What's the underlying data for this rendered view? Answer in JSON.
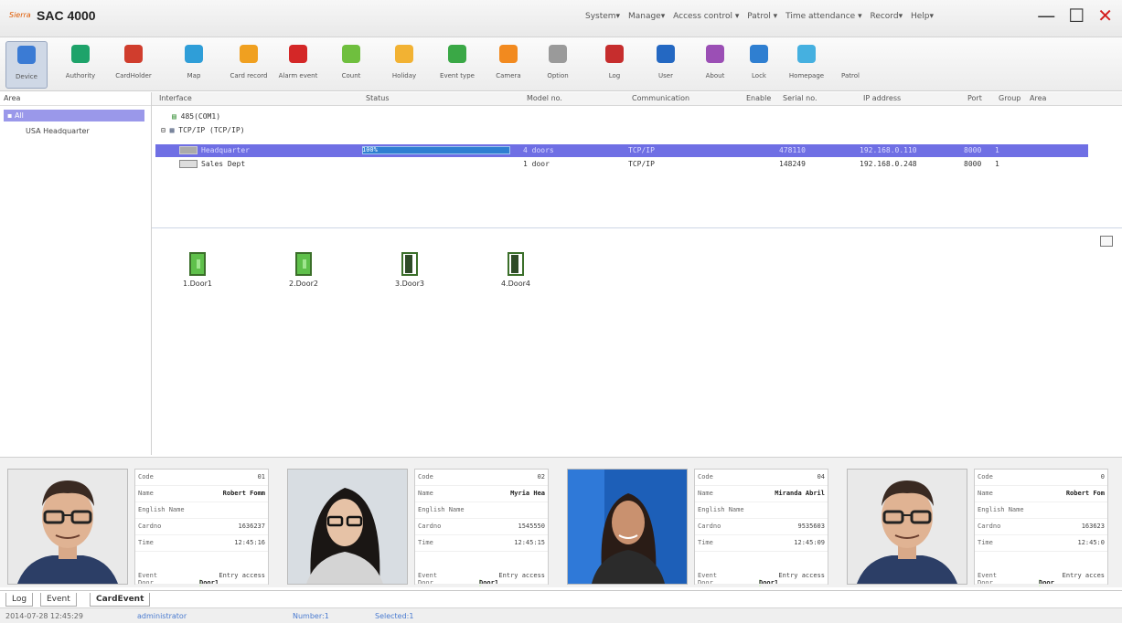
{
  "app": {
    "brand": "Sierra",
    "title": "SAC 4000"
  },
  "menu": [
    "System▾",
    "Manage▾",
    "Access control ▾",
    "Patrol ▾",
    "Time attendance ▾",
    "Record▾",
    "Help▾"
  ],
  "window_controls": {
    "minimize": "—",
    "maximize": "☐",
    "close": "✕"
  },
  "toolbar": [
    {
      "label": "Device",
      "icon": "device-icon",
      "color": "#3b7bd4",
      "active": true
    },
    {
      "label": "Authority",
      "icon": "authority-icon",
      "color": "#1ea36a"
    },
    {
      "label": "CardHolder",
      "icon": "cardholder-icon",
      "color": "#d03d2d"
    },
    {
      "label": "Map",
      "icon": "map-icon",
      "color": "#2f9ed8"
    },
    {
      "label": "Card record",
      "icon": "card-record-icon",
      "color": "#f0a020"
    },
    {
      "label": "Alarm event",
      "icon": "alarm-icon",
      "color": "#d42727"
    },
    {
      "label": "Count",
      "icon": "count-icon",
      "color": "#6fbf3e"
    },
    {
      "label": "Holiday",
      "icon": "holiday-icon",
      "color": "#f2b233"
    },
    {
      "label": "Event type",
      "icon": "event-type-icon",
      "color": "#3aa846"
    },
    {
      "label": "Camera",
      "icon": "camera-icon",
      "color": "#f28a1f"
    },
    {
      "label": "Option",
      "icon": "option-icon",
      "color": "#9a9a9a"
    },
    {
      "label": "Log",
      "icon": "log-icon",
      "color": "#c62d2d"
    },
    {
      "label": "User",
      "icon": "user-icon",
      "color": "#2468c2"
    },
    {
      "label": "About",
      "icon": "about-icon",
      "color": "#9b4fb5"
    },
    {
      "label": "Lock",
      "icon": "lock-icon",
      "color": "#2f7fd1"
    },
    {
      "label": "Homepage",
      "icon": "homepage-icon",
      "color": "#45b0e0"
    },
    {
      "label": "Patrol",
      "icon": "patrol-icon",
      "color": ""
    }
  ],
  "sidebar": {
    "header": "Area",
    "selected": "All",
    "children": [
      "USA Headquarter"
    ]
  },
  "grid": {
    "columns": [
      "Interface",
      "Status",
      "Model no.",
      "Communication",
      "Enable",
      "Serial no.",
      "IP address",
      "Port",
      "Group",
      "Area"
    ],
    "tree": [
      "485(COM1)",
      "TCP/IP (TCP/IP)"
    ],
    "rows": [
      {
        "interface": "Headquarter",
        "status": "100%",
        "status_fill": 1.0,
        "model": "4 doors",
        "comm": "TCP/IP",
        "enable": "",
        "serial": "478110",
        "ip": "192.168.0.110",
        "port": "8000",
        "group": "1",
        "area": "",
        "selected": true
      },
      {
        "interface": "Sales Dept",
        "status": "",
        "status_fill": 0,
        "model": "1 door",
        "comm": "TCP/IP",
        "enable": "",
        "serial": "148249",
        "ip": "192.168.0.248",
        "port": "8000",
        "group": "1",
        "area": "",
        "selected": false
      }
    ]
  },
  "doors": [
    {
      "label": "1.Door1",
      "state": "open"
    },
    {
      "label": "2.Door2",
      "state": "open"
    },
    {
      "label": "3.Door3",
      "state": "closed"
    },
    {
      "label": "4.Door4",
      "state": "closed"
    }
  ],
  "card_events": [
    {
      "code": "01",
      "name": "Robert Fomm",
      "english_name": "",
      "card_no": "1636237",
      "time": "12:45:16",
      "door": "Door1",
      "event": "Entry access",
      "photo": "man"
    },
    {
      "code": "02",
      "name": "Myria Hea",
      "english_name": "",
      "card_no": "1545550",
      "time": "12:45:15",
      "door": "Door1",
      "event": "Entry access",
      "photo": "woman-dark"
    },
    {
      "code": "04",
      "name": "Miranda Abril",
      "english_name": "",
      "card_no": "9535603",
      "time": "12:45:09",
      "door": "Door1",
      "event": "Entry access",
      "photo": "woman-blue"
    },
    {
      "code": "0",
      "name": "Robert Fom",
      "english_name": "",
      "card_no": "163623",
      "time": "12:45:0",
      "door": "Door",
      "event": "Entry acces",
      "photo": "man"
    }
  ],
  "card_field_labels": {
    "code": "Code",
    "name": "Name",
    "english_name": "English Name",
    "card_no": "Cardno",
    "time": "Time",
    "door": "Door",
    "event": "Event"
  },
  "bottom_tabs": [
    "Log",
    "Event",
    "CardEvent"
  ],
  "statusbar": {
    "datetime": "2014-07-28 12:45:29",
    "user": "administrator",
    "number": "Number:1",
    "selected": "Selected:1"
  }
}
